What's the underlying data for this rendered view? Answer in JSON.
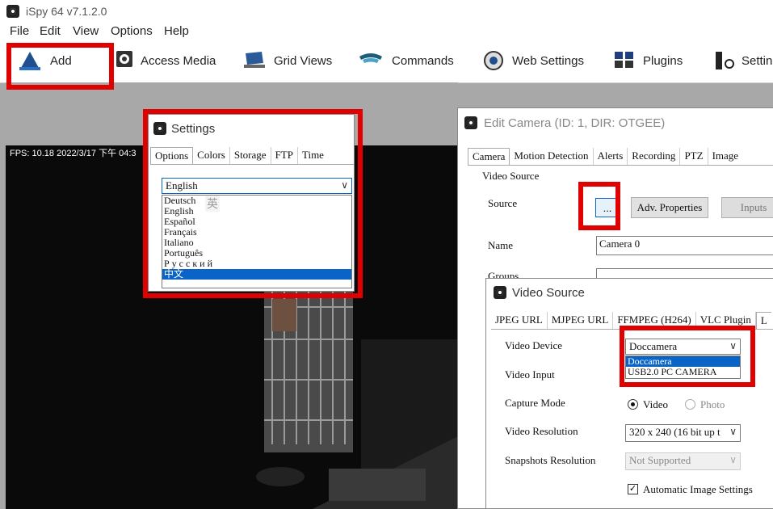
{
  "app": {
    "title": "iSpy 64 v7.1.2.0"
  },
  "menu": [
    "File",
    "Edit",
    "View",
    "Options",
    "Help"
  ],
  "toolbar": {
    "add": "Add",
    "access_media": "Access Media",
    "grid_views": "Grid Views",
    "commands": "Commands",
    "web_settings": "Web Settings",
    "plugins": "Plugins",
    "settings": "Setting"
  },
  "camera_view": {
    "overlay": "FPS: 10.18 2022/3/17 下午 04:3"
  },
  "settings_dialog": {
    "title": "Settings",
    "tabs": [
      "Options",
      "Colors",
      "Storage",
      "FTP",
      "Time"
    ],
    "language_selected": "English",
    "language_options": [
      "Deutsch",
      "English",
      "Español",
      "Français",
      "Italiano",
      "Português",
      "Р у с с к и й",
      "中文"
    ],
    "ime_hint": "英"
  },
  "edit_camera": {
    "title": "Edit Camera (ID: 1, DIR: OTGEE)",
    "tabs": [
      "Camera",
      "Motion Detection",
      "Alerts",
      "Recording",
      "PTZ",
      "Image"
    ],
    "video_source_group": "Video Source",
    "source_label": "Source",
    "browse_button": "...",
    "adv_properties_button": "Adv. Properties",
    "inputs_button": "Inputs",
    "name_label": "Name",
    "name_value": "Camera 0",
    "groups_label": "Groups"
  },
  "video_source": {
    "title": "Video Source",
    "tabs": [
      "JPEG URL",
      "MJPEG URL",
      "FFMPEG (H264)",
      "VLC Plugin",
      "L"
    ],
    "video_device_label": "Video Device",
    "video_device_selected": "Doccamera",
    "video_device_options": [
      "Doccamera",
      "USB2.0 PC CAMERA"
    ],
    "video_input_label": "Video Input",
    "capture_mode_label": "Capture Mode",
    "capture_video": "Video",
    "capture_photo": "Photo",
    "video_resolution_label": "Video Resolution",
    "video_resolution_value": "320 x 240 (16 bit up t",
    "snapshots_resolution_label": "Snapshots Resolution",
    "snapshots_resolution_value": "Not Supported",
    "auto_image_settings": "Automatic Image Settings"
  },
  "colors": {
    "highlight": "#e00000",
    "selection": "#0a64c8"
  }
}
